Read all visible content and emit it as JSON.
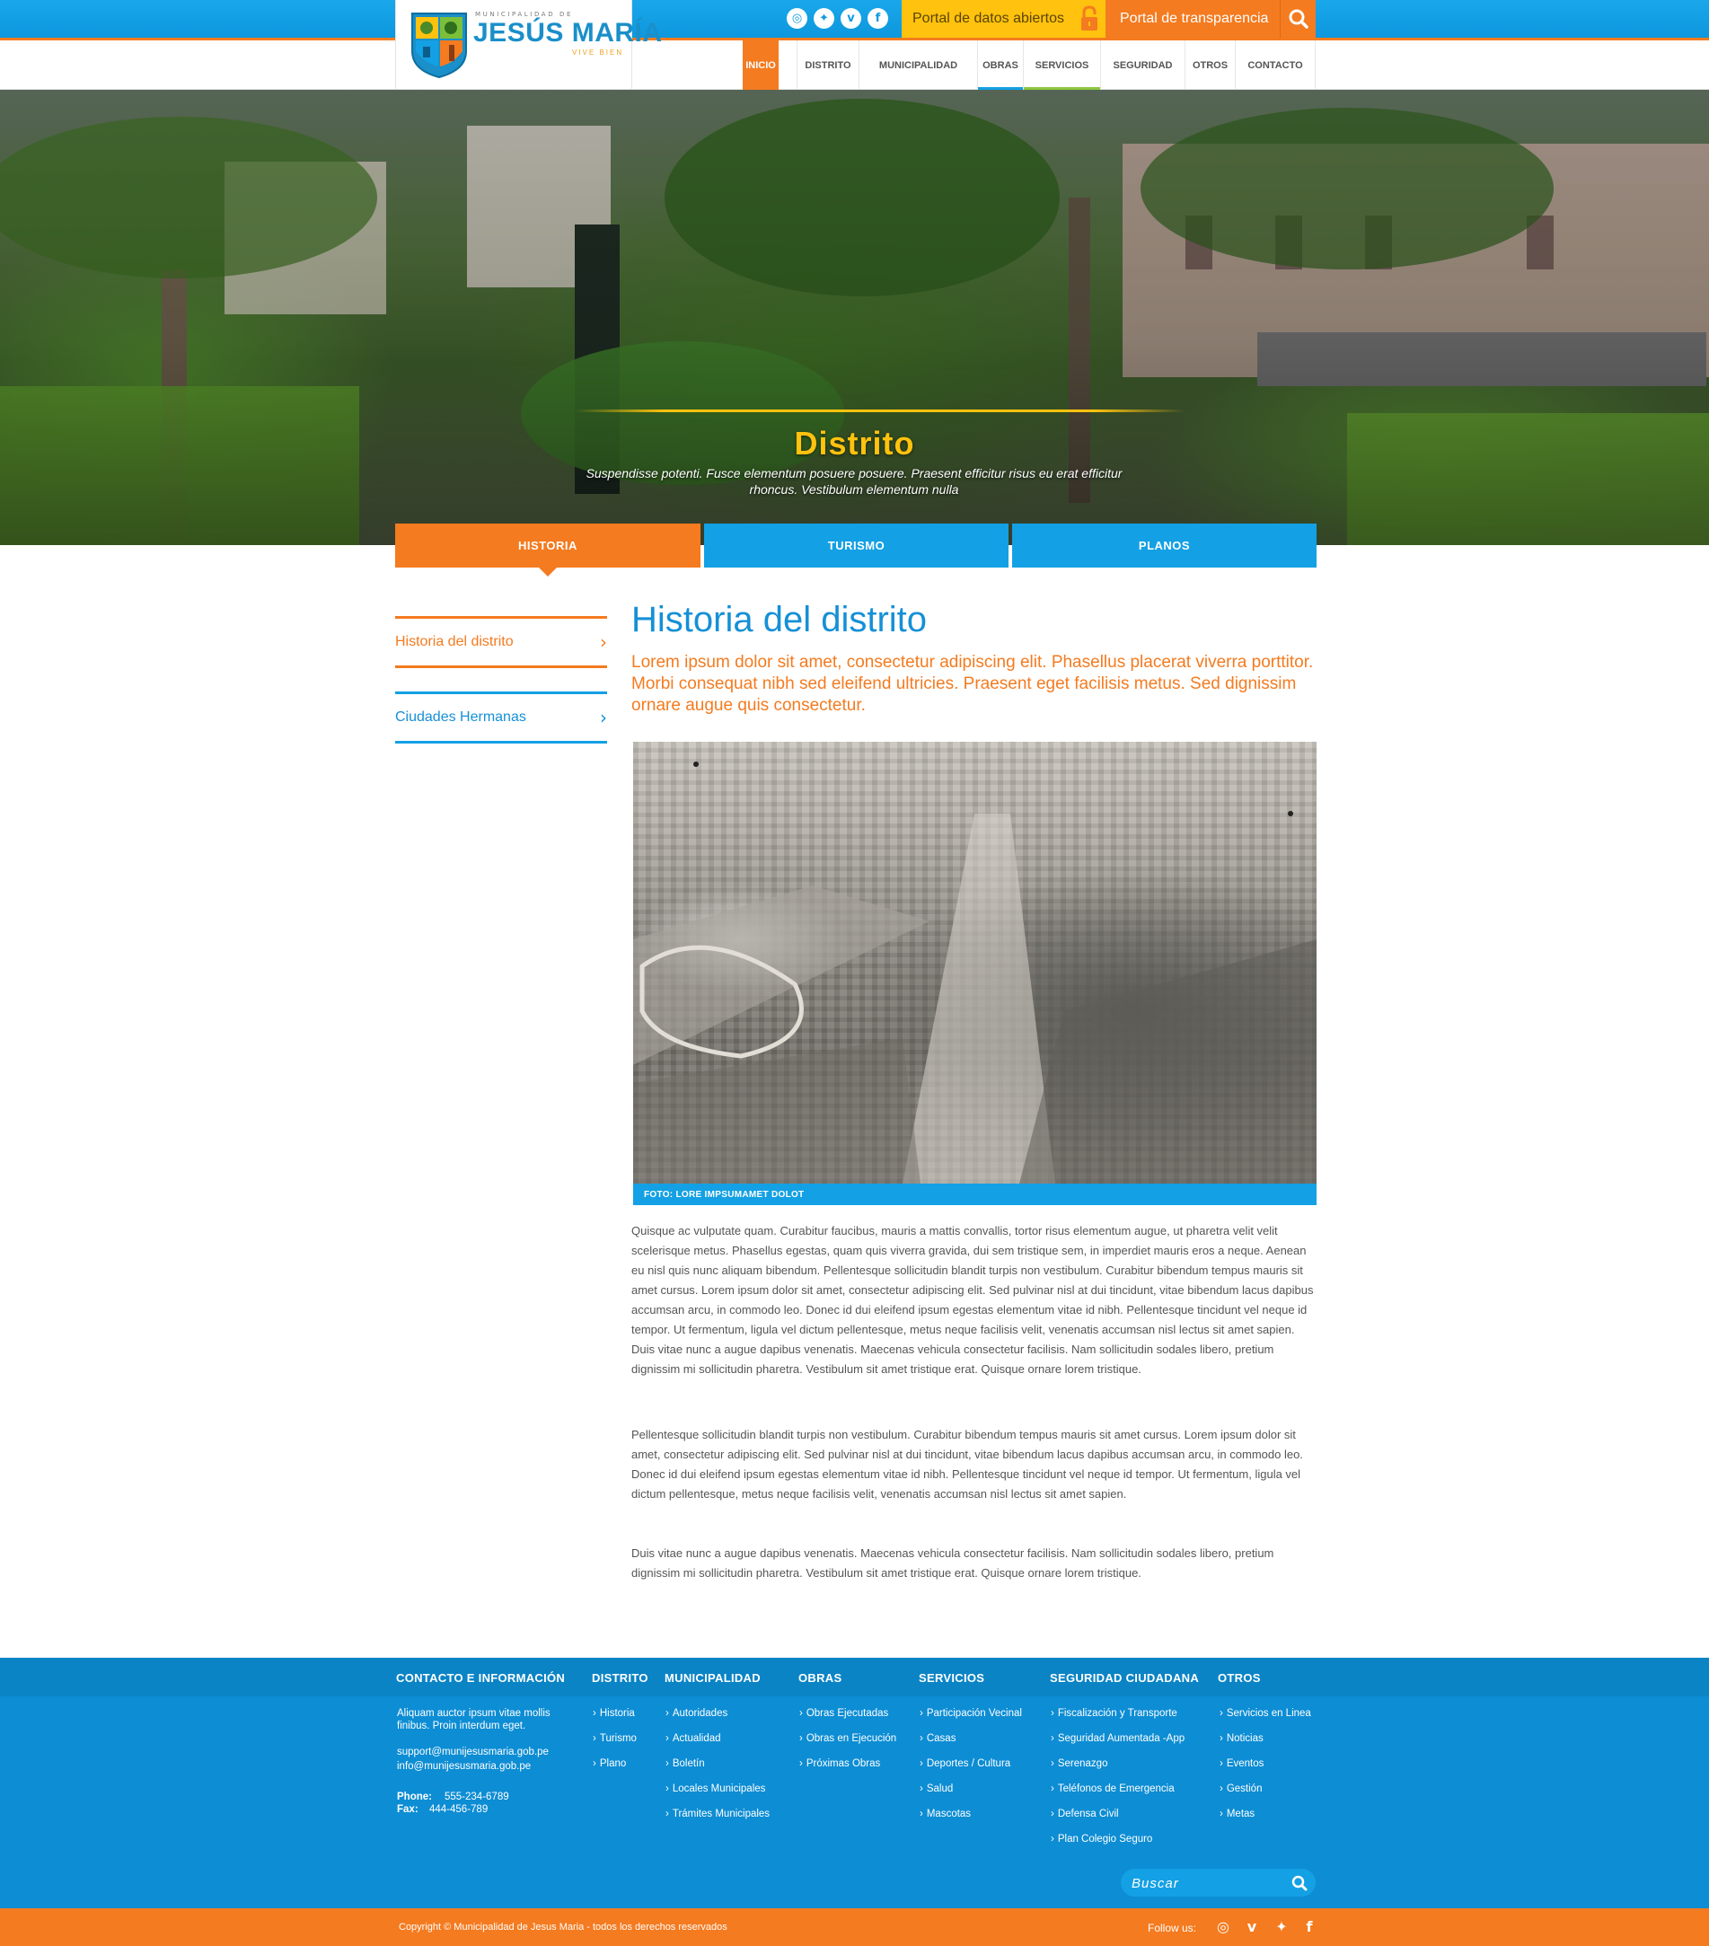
{
  "header": {
    "logo": {
      "small": "MUNICIPALIDAD DE",
      "big": "JESÚS MARÍA",
      "tagline": "VIVE BIEN"
    },
    "social_top": [
      {
        "icon": "instagram-icon",
        "glyph": "◎"
      },
      {
        "icon": "twitter-icon",
        "glyph": "✦"
      },
      {
        "icon": "vine-icon",
        "glyph": "v"
      },
      {
        "icon": "facebook-icon",
        "glyph": "f"
      }
    ],
    "portal_datos": "Portal de datos abiertos",
    "portal_transparencia": "Portal de transparencia",
    "nav": [
      {
        "label": "INICIO"
      },
      {
        "label": "DISTRITO"
      },
      {
        "label": "MUNICIPALIDAD"
      },
      {
        "label": "OBRAS"
      },
      {
        "label": "SERVICIOS"
      },
      {
        "label": "SEGURIDAD"
      },
      {
        "label": "OTROS"
      },
      {
        "label": "CONTACTO"
      }
    ]
  },
  "hero": {
    "title": "Distrito",
    "subtitle": "Suspendisse potenti. Fusce elementum posuere posuere. Praesent efficitur risus eu erat efficitur rhoncus. Vestibulum elementum nulla"
  },
  "tabs": [
    {
      "label": "HISTORIA",
      "active": true
    },
    {
      "label": "TURISMO",
      "active": false
    },
    {
      "label": "PLANOS",
      "active": false
    }
  ],
  "sidebar": {
    "items": [
      {
        "label": "Historia del distrito",
        "chevron": "›"
      },
      {
        "label": "Ciudades Hermanas",
        "chevron": "›"
      }
    ]
  },
  "main": {
    "title": "Historia del distrito",
    "lead": "Lorem ipsum dolor sit amet, consectetur adipiscing elit. Phasellus placerat viverra porttitor. Morbi consequat nibh sed eleifend ultricies. Praesent eget facilisis metus. Sed dignissim ornare augue quis consectetur.",
    "photo_caption": "FOTO: LORE IMPSUMAMET DOLOT",
    "paragraphs": [
      "Quisque ac vulputate quam. Curabitur faucibus, mauris a mattis convallis, tortor risus elementum augue, ut pharetra velit velit scelerisque metus. Phasellus egestas, quam quis viverra gravida, dui sem tristique sem, in imperdiet mauris eros a neque. Aenean eu nisl quis nunc aliquam bibendum. Pellentesque sollicitudin blandit turpis non vestibulum. Curabitur bibendum tempus mauris sit amet cursus. Lorem ipsum dolor sit amet, consectetur adipiscing elit. Sed pulvinar nisl at dui tincidunt, vitae bibendum lacus dapibus accumsan arcu, in commodo leo. Donec id dui eleifend ipsum egestas elementum vitae id nibh. Pellentesque tincidunt vel neque id tempor. Ut fermentum, ligula vel dictum pellentesque, metus neque facilisis velit, venenatis accumsan nisl lectus sit amet sapien. Duis vitae nunc a augue dapibus venenatis. Maecenas vehicula consectetur facilisis. Nam sollicitudin sodales libero, pretium dignissim mi sollicitudin pharetra. Vestibulum sit amet tristique erat. Quisque ornare lorem tristique.",
      "Pellentesque sollicitudin blandit turpis non vestibulum. Curabitur bibendum tempus mauris sit amet cursus. Lorem ipsum dolor sit amet, consectetur adipiscing elit. Sed pulvinar nisl at dui tincidunt, vitae bibendum lacus dapibus accumsan arcu, in commodo leo. Donec id dui eleifend ipsum egestas elementum vitae id nibh. Pellentesque tincidunt vel neque id tempor. Ut fermentum, ligula vel dictum pellentesque, metus neque facilisis velit, venenatis accumsan nisl lectus sit amet sapien.",
      "Duis vitae nunc a augue dapibus venenatis. Maecenas vehicula consectetur facilisis. Nam sollicitudin sodales libero, pretium dignissim mi sollicitudin pharetra. Vestibulum sit amet tristique erat. Quisque ornare lorem tristique."
    ]
  },
  "footer": {
    "contact": {
      "heading": "CONTACTO E INFORMACIÓN",
      "text": "Aliquam auctor ipsum vitae mollis finibus. Proin interdum eget.",
      "email1": "support@munijesusmaria.gob.pe",
      "email2": "info@munijesusmaria.gob.pe",
      "phone_label": "Phone:",
      "phone": "555-234-6789",
      "fax_label": "Fax:",
      "fax": "444-456-789"
    },
    "columns": [
      {
        "heading": "DISTRITO",
        "links": [
          "Historia",
          "Turismo",
          "Plano"
        ]
      },
      {
        "heading": "MUNICIPALIDAD",
        "links": [
          "Autoridades",
          "Actualidad",
          "Boletín",
          "Locales Municipales",
          "Trámites Municipales"
        ]
      },
      {
        "heading": "OBRAS",
        "links": [
          "Obras Ejecutadas",
          "Obras en Ejecución",
          "Próximas Obras"
        ]
      },
      {
        "heading": "SERVICIOS",
        "links": [
          "Participación Vecinal",
          "Casas",
          "Deportes / Cultura",
          "Salud",
          "Mascotas"
        ]
      },
      {
        "heading": "SEGURIDAD CIUDADANA",
        "links": [
          "Fiscalización y Transporte",
          "Seguridad Aumentada -App",
          "Serenazgo",
          "Teléfonos de Emergencia",
          "Defensa Civil",
          "Plan Colegio Seguro"
        ]
      },
      {
        "heading": "OTROS",
        "links": [
          "Servicios en Linea",
          "Noticias",
          "Eventos",
          "Gestión",
          "Metas"
        ]
      }
    ],
    "search_placeholder": "Buscar",
    "copyright": "Copyright © Municipalidad de Jesus Maria - todos los derechos reservados",
    "follow_label": "Follow us:",
    "social_bottom": [
      {
        "icon": "instagram-icon",
        "glyph": "◎"
      },
      {
        "icon": "vine-icon",
        "glyph": "v"
      },
      {
        "icon": "twitter-icon",
        "glyph": "✦"
      },
      {
        "icon": "facebook-icon",
        "glyph": "f"
      }
    ]
  },
  "colors": {
    "blue": "#14a0e4",
    "orange": "#f47b20",
    "yellow": "#ffc20e",
    "footer_blue": "#0d8dd4"
  }
}
